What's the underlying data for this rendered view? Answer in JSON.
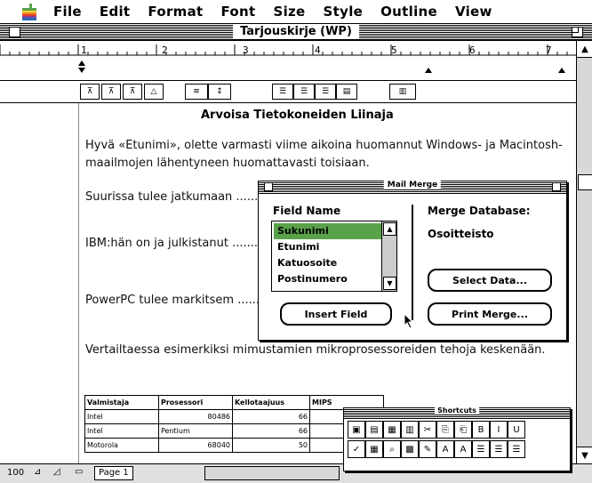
{
  "menubar": {
    "items": [
      "File",
      "Edit",
      "Format",
      "Font",
      "Size",
      "Style",
      "Outline",
      "View"
    ]
  },
  "window": {
    "title": "Tarjouskirje (WP)"
  },
  "ruler": {
    "labels": [
      "1",
      "2",
      "3",
      "4",
      "5",
      "6",
      "7"
    ]
  },
  "document": {
    "heading": "Arvoisa Tietokoneiden Liinaja",
    "paragraphs": [
      "Hyvä «Etunimi», olette varmasti viime aikoina huomannut Windows- ja Macintosh-maailmojen lähentyneen huomattavasti toisiaan.",
      "Suurissa tulee jatkumaan ........................................ pohjautuvien tietokoneide ...",
      "IBM:hän on ja julkistanut ........................................ Apple on kevään aikana es ...",
      "PowerPC tulee markitsem ........................................ eteenpäin.",
      "Vertailtaessa esimerkiksi mimustamien mikroprosessoreiden tehoja keskenään."
    ],
    "table": {
      "headers": [
        "Valmistaja",
        "Prosessori",
        "Kellotaajuus",
        "MIPS"
      ],
      "rows": [
        [
          "Intel",
          "80486",
          "66",
          ""
        ],
        [
          "Intel",
          "Pentium",
          "66",
          ""
        ],
        [
          "Motorola",
          "68040",
          "50",
          ""
        ]
      ]
    }
  },
  "status": {
    "zoom": "100",
    "page": "Page 1"
  },
  "mailmerge": {
    "title": "Mail Merge",
    "field_name_label": "Field Name",
    "fields": [
      "Sukunimi",
      "Etunimi",
      "Katuosoite",
      "Postinumero"
    ],
    "selected_index": 0,
    "insert_button": "Insert Field",
    "merge_db_label": "Merge Database:",
    "merge_db_value": "Osoitteisto",
    "select_button": "Select Data...",
    "print_button": "Print Merge..."
  },
  "shortcuts": {
    "title": "Shortcuts"
  }
}
